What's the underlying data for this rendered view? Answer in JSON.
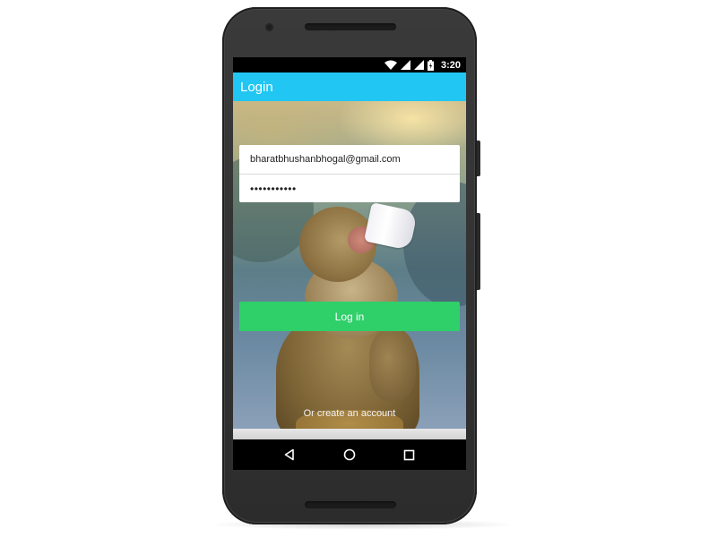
{
  "status_bar": {
    "time": "3:20",
    "icons": [
      "wifi-icon",
      "cell-signal-icon",
      "cell-signal-icon",
      "battery-charging-icon"
    ]
  },
  "app_bar": {
    "title": "Login"
  },
  "form": {
    "email_value": "bharatbhushanbhogal@gmail.com",
    "password_value": "•••••••••••"
  },
  "login_button": {
    "label": "Log in"
  },
  "create_account": {
    "label": "Or create an account"
  },
  "navigation": {
    "icons": [
      "back-icon",
      "home-icon",
      "recents-icon"
    ]
  },
  "colors": {
    "app_bar": "#21c6f3",
    "login_button": "#2fcf6a",
    "phone_body": "#2c2c2c"
  }
}
